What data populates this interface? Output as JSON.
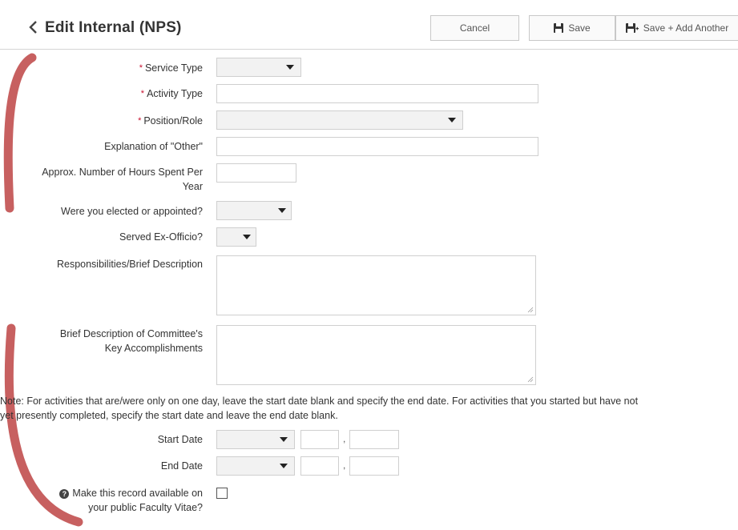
{
  "header": {
    "title": "Edit Internal (NPS)",
    "cancel_label": "Cancel",
    "save_label": "Save",
    "save_add_label": "Save + Add Another"
  },
  "form": {
    "service_type_label": "Service Type",
    "activity_type_label": "Activity Type",
    "position_role_label": "Position/Role",
    "explanation_other_label": "Explanation of \"Other\"",
    "hours_label_line1": "Approx. Number of Hours Spent Per",
    "hours_label_line2": "Year",
    "elected_label": "Were you elected or appointed?",
    "ex_officio_label": "Served Ex-Officio?",
    "responsibilities_label": "Responsibilities/Brief Description",
    "accomplishments_label_line1": "Brief Description of Committee's",
    "accomplishments_label_line2": "Key Accomplishments",
    "note_line1": "Note: For activities that are/were only on one day, leave the start date blank and specify the end date. For activities that you started but have not",
    "note_line2": "yet presently completed, specify the start date and leave the end date blank.",
    "start_date_label": "Start Date",
    "end_date_label": "End Date",
    "date_separator": ",",
    "public_label_line1": "Make this record available on",
    "public_label_line2": "your public Faculty Vitae?",
    "required_marker": "*"
  },
  "colors": {
    "required": "#c8102e",
    "decor_stroke": "#c76060"
  },
  "icons": [
    "chevron-left-icon",
    "save-icon",
    "save-add-icon",
    "dropdown-caret-icon",
    "help-icon",
    "resize-grip-icon"
  ]
}
